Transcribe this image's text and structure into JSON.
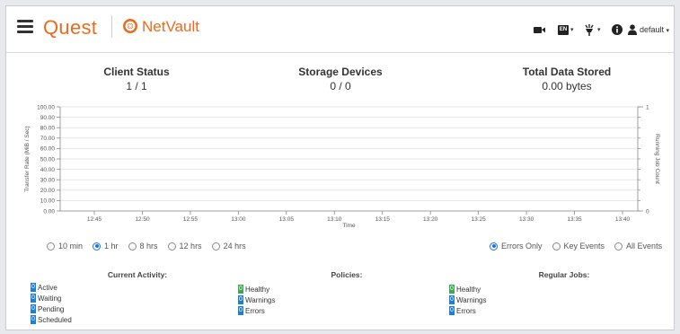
{
  "brand": {
    "quest": "Quest",
    "product": "NetVault"
  },
  "header": {
    "user": "default",
    "lang": "EN"
  },
  "stats": [
    {
      "label": "Client Status",
      "value": "1 / 1"
    },
    {
      "label": "Storage Devices",
      "value": "0 / 0"
    },
    {
      "label": "Total Data Stored",
      "value": "0.00 bytes"
    }
  ],
  "chart_data": {
    "type": "line",
    "ylabel": "Transfer Rate (MiB / Sec)",
    "y2label": "Running Job Count",
    "xlabel": "Time",
    "yticks": [
      "100.00",
      "90.00",
      "80.00",
      "70.00",
      "60.00",
      "50.00",
      "40.00",
      "30.00",
      "20.00",
      "10.00",
      "0.00"
    ],
    "ylim": [
      0,
      100
    ],
    "y2ticks": [
      "1",
      "0"
    ],
    "y2lim": [
      0,
      1
    ],
    "xticks": [
      "12:45",
      "12:50",
      "12:55",
      "13:00",
      "13:05",
      "13:10",
      "13:15",
      "13:20",
      "13:25",
      "13:30",
      "13:35",
      "13:40"
    ],
    "grid": true,
    "series": []
  },
  "time_ranges": [
    {
      "label": "10 min",
      "selected": false
    },
    {
      "label": "1 hr",
      "selected": true
    },
    {
      "label": "8 hrs",
      "selected": false
    },
    {
      "label": "12 hrs",
      "selected": false
    },
    {
      "label": "24 hrs",
      "selected": false
    }
  ],
  "event_filters": [
    {
      "label": "Errors Only",
      "selected": true
    },
    {
      "label": "Key Events",
      "selected": false
    },
    {
      "label": "All Events",
      "selected": false
    }
  ],
  "current_activity": {
    "title": "Current Activity:",
    "items": [
      {
        "count": "0",
        "label": "Active"
      },
      {
        "count": "0",
        "label": "Waiting"
      },
      {
        "count": "0",
        "label": "Pending"
      },
      {
        "count": "0",
        "label": "Scheduled"
      }
    ]
  },
  "policies": {
    "title": "Policies:",
    "items": [
      {
        "count": "0",
        "label": "Healthy",
        "color": "#3daa4f"
      },
      {
        "count": "0",
        "label": "Warnings",
        "color": "#1e7fd8"
      },
      {
        "count": "0",
        "label": "Errors",
        "color": "#1e7fd8"
      }
    ]
  },
  "regular_jobs": {
    "title": "Regular Jobs:",
    "items": [
      {
        "count": "0",
        "label": "Healthy",
        "color": "#3daa4f"
      },
      {
        "count": "0",
        "label": "Warnings",
        "color": "#1e7fd8"
      },
      {
        "count": "0",
        "label": "Errors",
        "color": "#1e7fd8"
      }
    ]
  }
}
